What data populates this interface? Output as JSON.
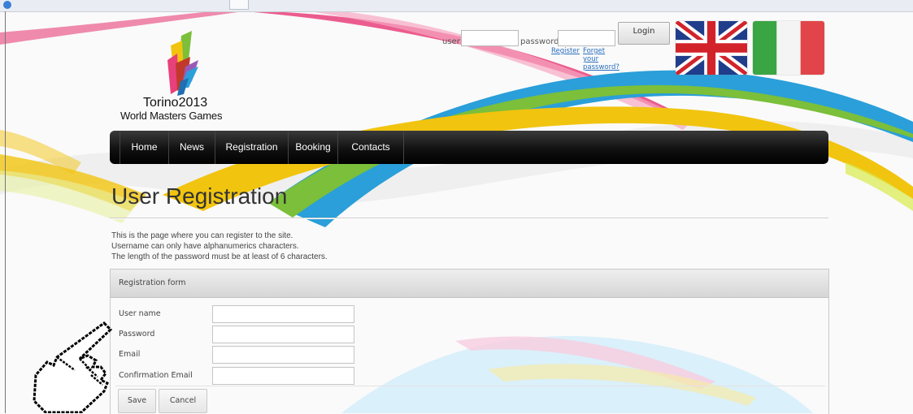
{
  "header": {
    "logo_line1": "Torino2013",
    "logo_line2": "World Masters Games",
    "login": {
      "user_label": "user",
      "password_label": "password",
      "login_button": "Login",
      "register_link": "Register",
      "forgot_link": "Forget your password?"
    },
    "flags": [
      "uk-flag-icon",
      "italy-flag-icon"
    ]
  },
  "nav": {
    "items": [
      "Home",
      "News",
      "Registration",
      "Booking",
      "Contacts"
    ]
  },
  "main": {
    "title": "User Registration",
    "intro": [
      "This is the page where you can register to the site.",
      "Username can only have alphanumerics characters.",
      "The length of the password must be at least of 6 characters."
    ]
  },
  "form": {
    "heading": "Registration form",
    "fields": [
      {
        "label": "User name",
        "value": ""
      },
      {
        "label": "Password",
        "value": ""
      },
      {
        "label": "Email",
        "value": ""
      },
      {
        "label": "Confirmation Email",
        "value": ""
      }
    ],
    "save_label": "Save",
    "cancel_label": "Cancel"
  },
  "colors": {
    "nav_bg": "#111111",
    "link": "#2a6fbf",
    "ribbon_blue": "#2a9fd9",
    "ribbon_yellow": "#f1c40f",
    "ribbon_pink": "#e8407a",
    "ribbon_green": "#7bbf3a"
  }
}
